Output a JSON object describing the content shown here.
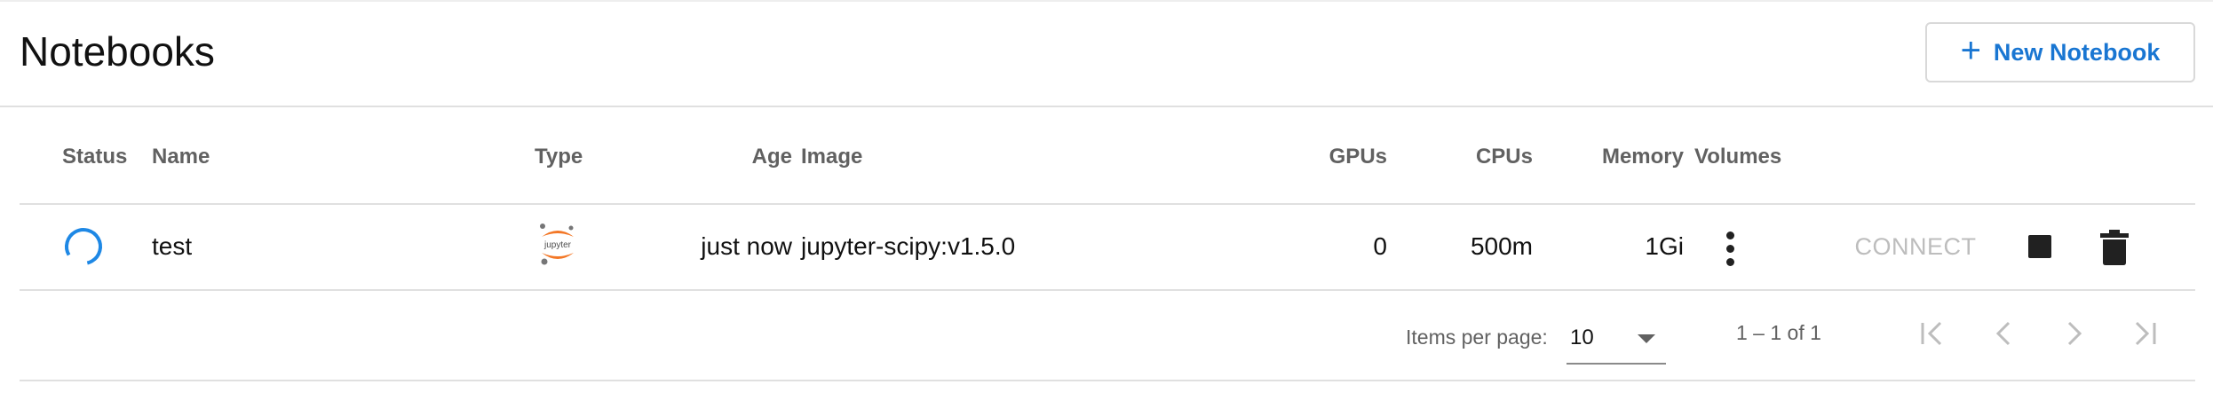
{
  "header": {
    "title": "Notebooks",
    "new_button_icon": "plus-icon",
    "new_button_label": "New Notebook"
  },
  "table": {
    "columns": [
      "Status",
      "Name",
      "Type",
      "Age",
      "Image",
      "GPUs",
      "CPUs",
      "Memory",
      "Volumes"
    ],
    "rows": [
      {
        "status_icon": "loading-spinner-icon",
        "name": "test",
        "type_icon": "jupyter-logo-icon",
        "type_logo_text": "jupyter",
        "age": "just now",
        "image": "jupyter-scipy:v1.5.0",
        "gpus": "0",
        "cpus": "500m",
        "memory": "1Gi",
        "volumes_icon": "more-vert-icon",
        "connect_label": "CONNECT",
        "stop_icon": "stop-icon",
        "delete_icon": "delete-icon"
      }
    ]
  },
  "paginator": {
    "items_per_page_label": "Items per page:",
    "page_size": "10",
    "range_label": "1 – 1 of 1"
  },
  "colors": {
    "accent": "#1976d2",
    "spinner": "#1e88e5",
    "jupyter_orange": "#f37726",
    "disabled_text": "#bdbdbd"
  }
}
